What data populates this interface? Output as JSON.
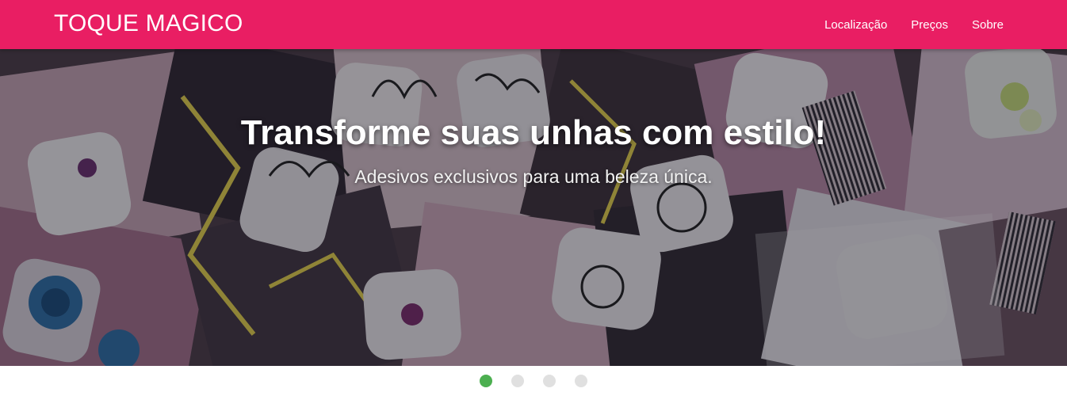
{
  "header": {
    "brand": "TOQUE MAGICO",
    "nav": [
      {
        "label": "Localização"
      },
      {
        "label": "Preços"
      },
      {
        "label": "Sobre"
      }
    ]
  },
  "hero": {
    "title": "Transforme suas unhas com estilo!",
    "subtitle": "Adesivos exclusivos para uma beleza única."
  },
  "carousel": {
    "slide_count": 4,
    "active_index": 0
  },
  "colors": {
    "navbar": "#e91e63",
    "indicator_active": "#4caf50",
    "indicator_inactive": "#e0e0e0"
  }
}
